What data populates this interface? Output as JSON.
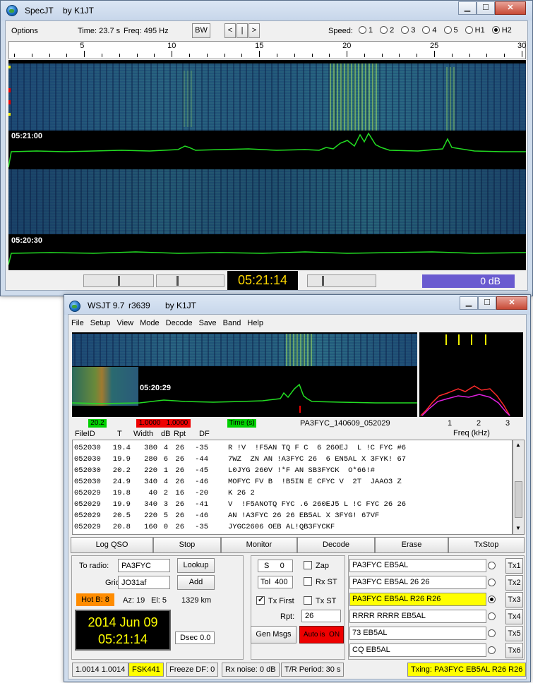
{
  "specjt": {
    "title": "SpecJT",
    "by": "by K1JT",
    "toolbar": {
      "options": "Options",
      "time": "Time: 23.7 s",
      "freq": "Freq: 495 Hz",
      "bw": "BW",
      "prev": "<",
      "pause": "|",
      "next": ">",
      "speed_label": "Speed:",
      "speeds": [
        {
          "label": "1",
          "on": false
        },
        {
          "label": "2",
          "on": false
        },
        {
          "label": "3",
          "on": false
        },
        {
          "label": "4",
          "on": false
        },
        {
          "label": "5",
          "on": false
        },
        {
          "label": "H1",
          "on": false
        },
        {
          "label": "H2",
          "on": true
        }
      ]
    },
    "scale_labels": [
      "5",
      "10",
      "15",
      "20",
      "25",
      "30"
    ],
    "timestamp1": "05:21:00",
    "timestamp2": "05:20:30",
    "clock": "05:21:14",
    "db": "0 dB"
  },
  "wsjt": {
    "title": "WSJT 9.7",
    "rev": "r3639",
    "by": "by K1JT",
    "menu": [
      "File",
      "Setup",
      "View",
      "Mode",
      "Decode",
      "Save",
      "Band",
      "Help"
    ],
    "wf_time": "05:20:29",
    "freq_scale": [
      "1",
      "2",
      "3"
    ],
    "freq_label": "Freq (kHz)",
    "ind_green": "20.2",
    "ind_red": "1.0000   1.0000",
    "ind_time": "Time (s)",
    "filename": "PA3FYC_140609_052029",
    "headers": [
      "FileID",
      "T",
      "Width",
      "dB",
      "Rpt",
      "DF"
    ],
    "decodes": [
      {
        "id": "052030",
        "t": "19.4",
        "w": "380",
        "db": "4",
        "rpt": "26",
        "df": "-35",
        "msg": "R !V  !F5AN TQ F C  6 260EJ  L !C FYC #6"
      },
      {
        "id": "052030",
        "t": "19.9",
        "w": "280",
        "db": "6",
        "rpt": "26",
        "df": "-44",
        "msg": "7WZ  ZN AN !A3FYC 26  6 EN5AL X 3FYK! 67"
      },
      {
        "id": "052030",
        "t": "20.2",
        "w": "220",
        "db": "1",
        "rpt": "26",
        "df": "-45",
        "msg": "L0JYG 260V !*F AN SB3FYCK  O*66!#"
      },
      {
        "id": "052030",
        "t": "24.9",
        "w": "340",
        "db": "4",
        "rpt": "26",
        "df": "-46",
        "msg": "MOFYC FV B  !B5IN E CFYC V  2T  JAAO3 Z"
      },
      {
        "id": "052029",
        "t": "19.8",
        "w": "40",
        "db": "2",
        "rpt": "16",
        "df": "-20",
        "msg": "K 26 2"
      },
      {
        "id": "052029",
        "t": "19.9",
        "w": "340",
        "db": "3",
        "rpt": "26",
        "df": "-41",
        "msg": "V  !F5ANOTQ FYC .6 260EJ5 L !C FYC 26 26"
      },
      {
        "id": "052029",
        "t": "20.5",
        "w": "220",
        "db": "5",
        "rpt": "26",
        "df": "-46",
        "msg": "AN !A3FYC 26 26 EB5AL X 3FYG! 67VF"
      },
      {
        "id": "052029",
        "t": "20.8",
        "w": "160",
        "db": "0",
        "rpt": "26",
        "df": "-35",
        "msg": "JYGC2606 OEB AL!QB3FYCKF"
      }
    ],
    "buttons": [
      "Log QSO",
      "Stop",
      "Monitor",
      "Decode",
      "Erase",
      "TxStop"
    ],
    "to_radio_label": "To radio:",
    "to_radio_value": "PA3FYC",
    "grid_label": "Grid:",
    "grid_value": "JO31af",
    "lookup": "Lookup",
    "add": "Add",
    "hotb": "Hot B: 8",
    "az": "Az: 19",
    "el": "El: 5",
    "dist": "1329 km",
    "date": "2014 Jun 09",
    "time": "05:21:14",
    "dsec_label": "Dsec",
    "dsec_value": "0.0",
    "s_label": "S",
    "s_value": "0",
    "tol_label": "Tol",
    "tol_value": "400",
    "zap": "Zap",
    "rxst": "Rx ST",
    "txfirst": "Tx First",
    "txst": "Tx ST",
    "rpt_label": "Rpt:",
    "rpt_value": "26",
    "genmsgs": "Gen Msgs",
    "auto": "Auto is  ON",
    "tx": [
      {
        "msg": "PA3FYC EB5AL",
        "btn": "Tx1",
        "on": false,
        "hl": false
      },
      {
        "msg": "PA3FYC EB5AL 26 26",
        "btn": "Tx2",
        "on": false,
        "hl": false
      },
      {
        "msg": "PA3FYC EB5AL R26 R26",
        "btn": "Tx3",
        "on": true,
        "hl": true
      },
      {
        "msg": "RRRR RRRR EB5AL",
        "btn": "Tx4",
        "on": false,
        "hl": false
      },
      {
        "msg": "73 EB5AL",
        "btn": "Tx5",
        "on": false,
        "hl": false
      },
      {
        "msg": "CQ EB5AL",
        "btn": "Tx6",
        "on": false,
        "hl": false
      }
    ],
    "status": {
      "s1": "1.0014 1.0014",
      "mode": "FSK441",
      "freeze": "Freeze DF:   0",
      "rxnoise": "Rx noise:  0 dB",
      "trperiod": "T/R Period: 30 s",
      "txing": "Txing:  PA3FYC EB5AL R26 R26"
    },
    "colors": {
      "green": "#00d000",
      "red": "#ee0000",
      "yellow": "#ffff00",
      "orange": "#ff8c00",
      "clock_bg": "#000000",
      "clock_fg": "#ffff00"
    }
  }
}
